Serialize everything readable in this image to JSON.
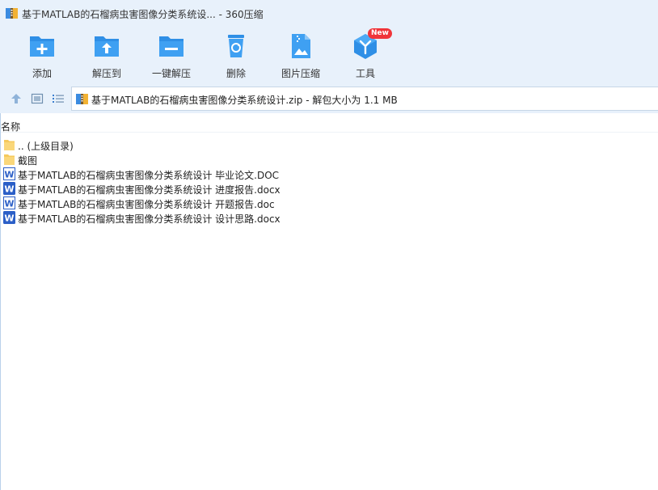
{
  "window": {
    "title": "基于MATLAB的石榴病虫害图像分类系统设... - 360压缩"
  },
  "toolbar": {
    "items": [
      {
        "label": "添加",
        "icon": "add-icon"
      },
      {
        "label": "解压到",
        "icon": "extract-to-icon"
      },
      {
        "label": "一键解压",
        "icon": "one-click-extract-icon"
      },
      {
        "label": "删除",
        "icon": "delete-icon"
      },
      {
        "label": "图片压缩",
        "icon": "image-compress-icon"
      },
      {
        "label": "工具",
        "icon": "tools-icon",
        "badge": "New"
      }
    ]
  },
  "nav": {
    "path": "基于MATLAB的石榴病虫害图像分类系统设计.zip - 解包大小为 1.1 MB"
  },
  "filelist": {
    "column_name": "名称",
    "rows": [
      {
        "name": ".. (上级目录)",
        "type": "folder"
      },
      {
        "name": "截图",
        "type": "folder"
      },
      {
        "name": "基于MATLAB的石榴病虫害图像分类系统设计 毕业论文.DOC",
        "type": "doc"
      },
      {
        "name": "基于MATLAB的石榴病虫害图像分类系统设计 进度报告.docx",
        "type": "docx"
      },
      {
        "name": "基于MATLAB的石榴病虫害图像分类系统设计 开题报告.doc",
        "type": "doc"
      },
      {
        "name": "基于MATLAB的石榴病虫害图像分类系统设计 设计思路.docx",
        "type": "docx"
      }
    ]
  },
  "colors": {
    "chrome": "#e8f1fb",
    "accent": "#2f8fe6",
    "badge": "#f0353a",
    "word": "#2b5fc7"
  }
}
